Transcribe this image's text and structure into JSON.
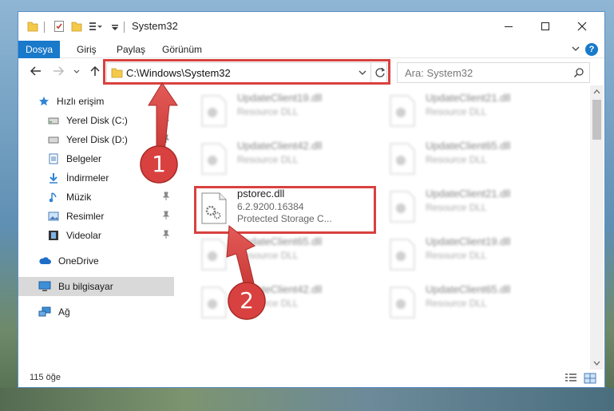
{
  "window": {
    "title": "System32",
    "controls": {
      "minimize": "minimize-icon",
      "maximize": "maximize-icon",
      "close": "close-icon"
    }
  },
  "ribbon": {
    "tabs": [
      "Dosya",
      "Giriş",
      "Paylaş",
      "Görünüm"
    ],
    "help": "?"
  },
  "nav": {
    "address": "C:\\Windows\\System32",
    "search_placeholder": "Ara: System32"
  },
  "sidebar": {
    "items": [
      {
        "label": "Hızlı erişim",
        "icon": "star-icon",
        "pinned": false
      },
      {
        "label": "Yerel Disk (C:)",
        "icon": "drive-icon",
        "pinned": true
      },
      {
        "label": "Yerel Disk (D:)",
        "icon": "drive-icon",
        "pinned": true
      },
      {
        "label": "Belgeler",
        "icon": "documents-icon",
        "pinned": true
      },
      {
        "label": "İndirmeler",
        "icon": "downloads-icon",
        "pinned": true
      },
      {
        "label": "Müzik",
        "icon": "music-icon",
        "pinned": true
      },
      {
        "label": "Resimler",
        "icon": "pictures-icon",
        "pinned": true
      },
      {
        "label": "Videolar",
        "icon": "videos-icon",
        "pinned": true
      },
      {
        "label": "OneDrive",
        "icon": "cloud-icon",
        "pinned": false
      },
      {
        "label": "Bu bilgisayar",
        "icon": "computer-icon",
        "pinned": false,
        "selected": true
      },
      {
        "label": "Ağ",
        "icon": "network-icon",
        "pinned": false
      }
    ]
  },
  "files": {
    "left": [
      {
        "name": "UpdateClient19.dll",
        "sub": "Resource DLL"
      },
      {
        "name": "UpdateClient42.dll",
        "sub": "Resource DLL"
      },
      {
        "name": "pstorec.dll",
        "version": "6.2.9200.16384",
        "description": "Protected Storage C...",
        "highlighted": true
      },
      {
        "name": "UpdateClient65.dll",
        "sub": "Resource DLL"
      },
      {
        "name": "UpdateClient42.dll",
        "sub": "Resource DLL"
      }
    ],
    "right": [
      {
        "name": "UpdateClient21.dll",
        "sub": "Resource DLL"
      },
      {
        "name": "UpdateClient65.dll",
        "sub": "Resource DLL"
      },
      {
        "name": "UpdateClient21.dll",
        "sub": "Resource DLL"
      },
      {
        "name": "UpdateClient19.dll",
        "sub": "Resource DLL"
      },
      {
        "name": "UpdateClient65.dll",
        "sub": "Resource DLL"
      }
    ]
  },
  "status": {
    "count": "115 öğe"
  },
  "annotations": {
    "step1": "1",
    "step2": "2",
    "color": "#d8413f"
  }
}
